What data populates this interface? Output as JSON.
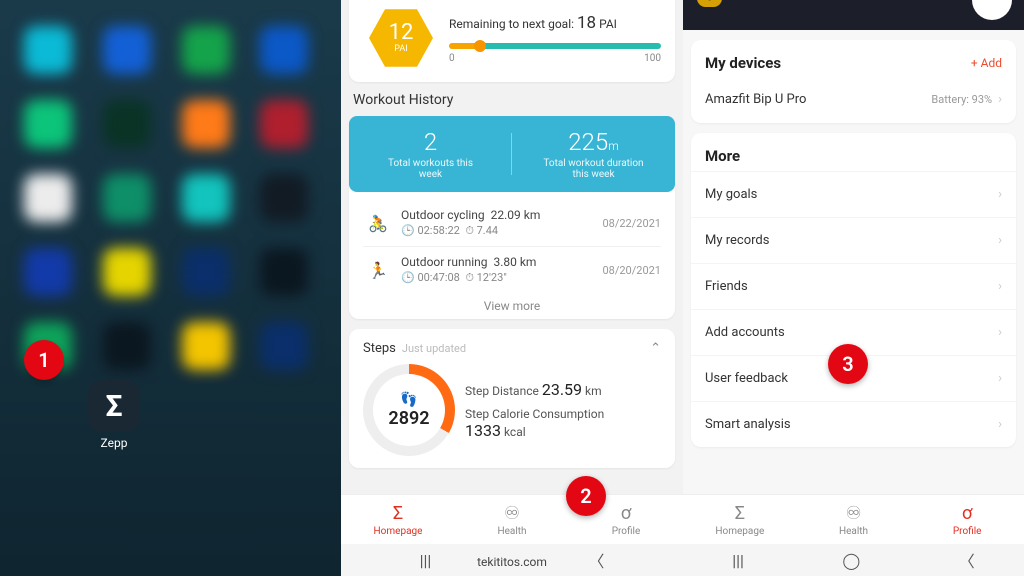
{
  "panel1": {
    "app_label": "Zepp",
    "app_glyph": "Σ",
    "badge": "1"
  },
  "panel2": {
    "pai": {
      "value": "12",
      "unit": "PAI",
      "remain_pre": "Remaining to next goal: ",
      "remain_val": "18",
      "remain_unit": " PAI",
      "scale_min": "0",
      "scale_max": "100"
    },
    "workout": {
      "title": "Workout History",
      "total_count": "2",
      "total_count_sub": "Total workouts this\nweek",
      "total_duration": "225",
      "total_duration_unit": "m",
      "total_duration_sub": "Total workout duration\nthis week",
      "items": [
        {
          "name": "Outdoor cycling",
          "dist": "22.09 km",
          "t1": "02:58:22",
          "t2": "7.44",
          "date": "08/22/2021"
        },
        {
          "name": "Outdoor running",
          "dist": "3.80 km",
          "t1": "00:47:08",
          "t2": "12'23\"",
          "date": "08/20/2021"
        }
      ],
      "view_more": "View more"
    },
    "steps": {
      "title": "Steps",
      "just": "Just updated",
      "count": "2892",
      "dist_label": "Step Distance",
      "dist_val": "23.59",
      "dist_unit": " km",
      "cal_label": "Step Calorie Consumption",
      "cal_val": "1333",
      "cal_unit": " kcal"
    },
    "tabs": {
      "home": "Homepage",
      "health": "Health",
      "profile": "Profile"
    },
    "watermark": "tekititos.com",
    "badge": "2"
  },
  "panel3": {
    "devices": {
      "title": "My devices",
      "add": "+ Add",
      "name": "Amazfit Bip U Pro",
      "battery": "Battery: 93%"
    },
    "more": {
      "title": "More",
      "rows": [
        "My goals",
        "My records",
        "Friends",
        "Add accounts",
        "User feedback",
        "Smart analysis"
      ]
    },
    "tabs": {
      "home": "Homepage",
      "health": "Health",
      "profile": "Profile"
    },
    "badge": "3"
  }
}
